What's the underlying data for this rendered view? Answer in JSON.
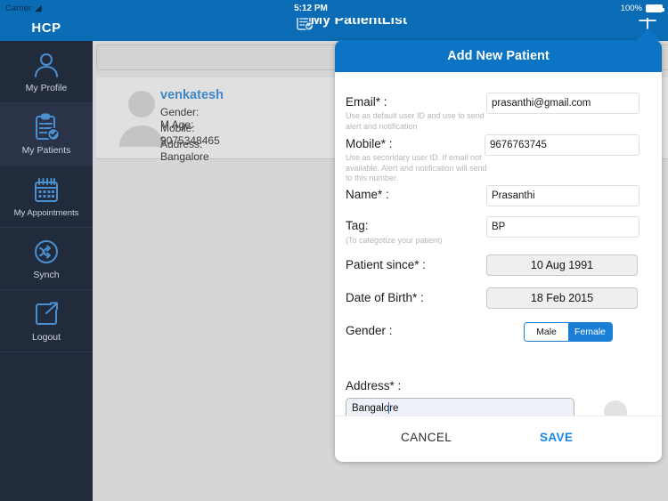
{
  "status_bar": {
    "carrier": "Carrier",
    "wifi_icon": "wifi-icon",
    "time": "5:12 PM",
    "battery_percent": "100%",
    "battery_icon": "battery-full-icon"
  },
  "sidebar": {
    "logo": "HCP",
    "items": [
      {
        "label": "My Profile",
        "icon": "user-icon",
        "active": false
      },
      {
        "label": "My Patients",
        "icon": "clipboard-check-icon",
        "active": true
      },
      {
        "label": "My Appointments",
        "icon": "calendar-icon",
        "active": false
      },
      {
        "label": "Synch",
        "icon": "sync-icon",
        "active": false
      },
      {
        "label": "Logout",
        "icon": "logout-icon",
        "active": false
      }
    ]
  },
  "topbar": {
    "title": "My PatientList",
    "title_icon": "clipboard-check-icon",
    "add_icon": "plus-icon"
  },
  "content": {
    "search_placeholder": "",
    "patient_card": {
      "avatar_icon": "avatar-placeholder-icon",
      "name": "venkatesh",
      "gender_line": "Gender:  M    Age:  -",
      "mobile_line": "Mobile:   9075348465",
      "address_line": "Address: Bangalore"
    }
  },
  "modal": {
    "title": "Add New Patient",
    "fields": {
      "email": {
        "label": "Email* :",
        "help": "Use as default user ID and use to send alert and notification",
        "value": "prasanthi@gmail.com",
        "placeholder": ""
      },
      "mobile": {
        "label": "Mobile* :",
        "help": "Use as secondary user ID. If email not available. Alert and notification will send to this number.",
        "value": "9676763745",
        "placeholder": ""
      },
      "name": {
        "label": "Name* :",
        "value": "Prasanthi",
        "placeholder": ""
      },
      "tag": {
        "label": "Tag:",
        "help": "(To categotize your patient)",
        "value": "BP",
        "placeholder": ""
      },
      "patient_since": {
        "label": "Patient since* :",
        "value": "10 Aug 1991"
      },
      "date_of_birth": {
        "label": "Date of Birth* :",
        "value": "18 Feb 2015"
      },
      "gender": {
        "label": "Gender :",
        "options": [
          "Male",
          "Female"
        ],
        "selected": "Female"
      },
      "address": {
        "label": "Address* :",
        "value": "Bangalore",
        "placeholder": "",
        "avatar_icon": "avatar-placeholder-icon"
      }
    },
    "buttons": {
      "cancel": "CANCEL",
      "save": "SAVE"
    }
  },
  "colors": {
    "brand_blue": "#0a6cb4",
    "modal_header_blue": "#0b74c4",
    "sidebar_dark": "#222b3c",
    "sidebar_active": "#2a3348",
    "accent_link": "#3f87c9",
    "save_blue": "#1a86e0",
    "segment_blue": "#1a7fd4"
  }
}
